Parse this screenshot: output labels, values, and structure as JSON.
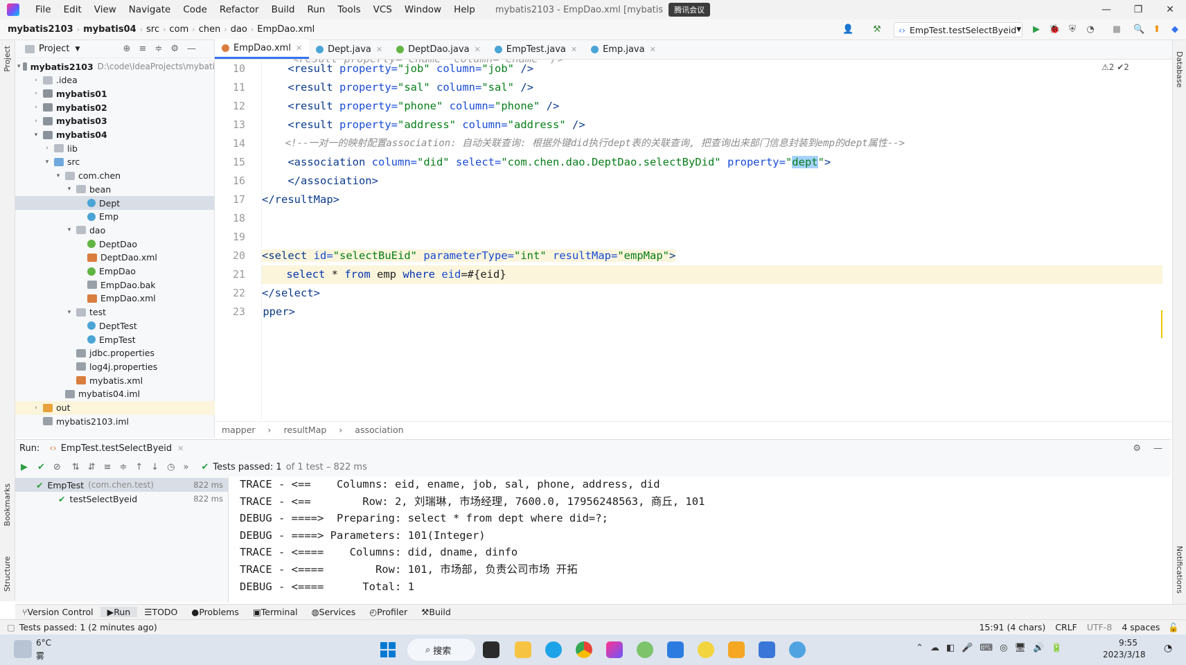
{
  "menubar": {
    "items": [
      "File",
      "Edit",
      "View",
      "Navigate",
      "Code",
      "Refactor",
      "Build",
      "Run",
      "Tools",
      "VCS",
      "Window",
      "Help"
    ],
    "window_title": "mybatis2103 - EmpDao.xml [mybatis",
    "meeting_badge": "腾讯会议",
    "win_minimize": "—",
    "win_restore": "❐",
    "win_close": "✕"
  },
  "navbar": {
    "crumbs": [
      "mybatis2103",
      "mybatis04",
      "src",
      "com",
      "chen",
      "dao",
      "EmpDao.xml"
    ],
    "run_config": "EmpTest.testSelectByeid"
  },
  "project": {
    "title": "Project",
    "tree": [
      {
        "label": "mybatis2103",
        "path": "D:\\code\\IdeaProjects\\mybati",
        "bold": true,
        "arrow": "▾",
        "icon": "modfolder",
        "level": 0
      },
      {
        "label": ".idea",
        "arrow": "›",
        "icon": "folder",
        "level": 1
      },
      {
        "label": "mybatis01",
        "arrow": "›",
        "icon": "modfolder",
        "level": 1,
        "bold": true
      },
      {
        "label": "mybatis02",
        "arrow": "›",
        "icon": "modfolder",
        "level": 1,
        "bold": true
      },
      {
        "label": "mybatis03",
        "arrow": "›",
        "icon": "modfolder",
        "level": 1,
        "bold": true
      },
      {
        "label": "mybatis04",
        "arrow": "▾",
        "icon": "modfolder",
        "level": 1,
        "bold": true
      },
      {
        "label": "lib",
        "arrow": "›",
        "icon": "folder",
        "level": 2
      },
      {
        "label": "src",
        "arrow": "▾",
        "icon": "srcfolder",
        "level": 2
      },
      {
        "label": "com.chen",
        "arrow": "▾",
        "icon": "folder",
        "level": 3
      },
      {
        "label": "bean",
        "arrow": "▾",
        "icon": "folder",
        "level": 4
      },
      {
        "label": "Dept",
        "arrow": "",
        "icon": "class",
        "level": 5,
        "selected": true
      },
      {
        "label": "Emp",
        "arrow": "",
        "icon": "class",
        "level": 5
      },
      {
        "label": "dao",
        "arrow": "▾",
        "icon": "folder",
        "level": 4
      },
      {
        "label": "DeptDao",
        "arrow": "",
        "icon": "iface",
        "level": 5
      },
      {
        "label": "DeptDao.xml",
        "arrow": "",
        "icon": "xml",
        "level": 5
      },
      {
        "label": "EmpDao",
        "arrow": "",
        "icon": "iface",
        "level": 5
      },
      {
        "label": "EmpDao.bak",
        "arrow": "",
        "icon": "file",
        "level": 5
      },
      {
        "label": "EmpDao.xml",
        "arrow": "",
        "icon": "xml",
        "level": 5
      },
      {
        "label": "test",
        "arrow": "▾",
        "icon": "folder",
        "level": 4
      },
      {
        "label": "DeptTest",
        "arrow": "",
        "icon": "class",
        "level": 5
      },
      {
        "label": "EmpTest",
        "arrow": "",
        "icon": "class",
        "level": 5
      },
      {
        "label": "jdbc.properties",
        "arrow": "",
        "icon": "file",
        "level": 4
      },
      {
        "label": "log4j.properties",
        "arrow": "",
        "icon": "file",
        "level": 4
      },
      {
        "label": "mybatis.xml",
        "arrow": "",
        "icon": "xml",
        "level": 4
      },
      {
        "label": "mybatis04.iml",
        "arrow": "",
        "icon": "file",
        "level": 3
      },
      {
        "label": "out",
        "arrow": "›",
        "icon": "orange",
        "level": 1,
        "highlight": true
      },
      {
        "label": "mybatis2103.iml",
        "arrow": "",
        "icon": "file",
        "level": 1
      }
    ]
  },
  "tabs": [
    {
      "label": "EmpDao.xml",
      "color": "#d97e3f",
      "active": true
    },
    {
      "label": "Dept.java",
      "color": "#4aa4d6"
    },
    {
      "label": "DeptDao.java",
      "color": "#62b543"
    },
    {
      "label": "EmpTest.java",
      "color": "#4aa4d6"
    },
    {
      "label": "Emp.java",
      "color": "#4aa4d6"
    }
  ],
  "editor": {
    "line_numbers": [
      "10",
      "11",
      "12",
      "13",
      "14",
      "15",
      "16",
      "17",
      "18",
      "19",
      "20",
      "21",
      "22",
      "23"
    ],
    "inspections": "⚠2 ✔2",
    "partial_top_line": "<result property=\"ename\" column=\"ename\" />"
  },
  "breadcrumb": [
    "mapper",
    "resultMap",
    "association"
  ],
  "run": {
    "label": "Run:",
    "config_tab": "EmpTest.testSelectByeid",
    "tests_passed": "Tests passed: 1",
    "tests_detail": "of 1 test – 822 ms",
    "tree": [
      {
        "label": "EmpTest",
        "sub": "(com.chen.test)",
        "time": "822 ms"
      },
      {
        "label": "testSelectByeid",
        "sub": "",
        "time": "822 ms"
      }
    ],
    "console": [
      "TRACE - <==    Columns: eid, ename, job, sal, phone, address, did",
      "TRACE - <==        Row: 2, 刘瑞琳, 市场经理, 7600.0, 17956248563, 商丘, 101",
      "DEBUG - ====>  Preparing: select * from dept where did=?;",
      "DEBUG - ====> Parameters: 101(Integer)",
      "TRACE - <====    Columns: did, dname, dinfo",
      "TRACE - <====        Row: 101, 市场部, 负责公司市场 开拓",
      "DEBUG - <====      Total: 1"
    ]
  },
  "bottomtabs": [
    "Version Control",
    "Run",
    "TODO",
    "Problems",
    "Terminal",
    "Services",
    "Profiler",
    "Build"
  ],
  "status": {
    "message": "Tests passed: 1 (2 minutes ago)",
    "position": "15:91 (4 chars)",
    "line_sep": "CRLF",
    "encoding": "UTF-8",
    "indent": "4 spaces"
  },
  "side_labels": {
    "project": "Project",
    "bookmarks": "Bookmarks",
    "structure": "Structure",
    "database": "Database",
    "notifications": "Notifications"
  },
  "taskbar": {
    "weather_temp": "6°C",
    "weather_desc": "雾",
    "search": "搜索",
    "time": "9:55",
    "date": "2023/3/18"
  }
}
